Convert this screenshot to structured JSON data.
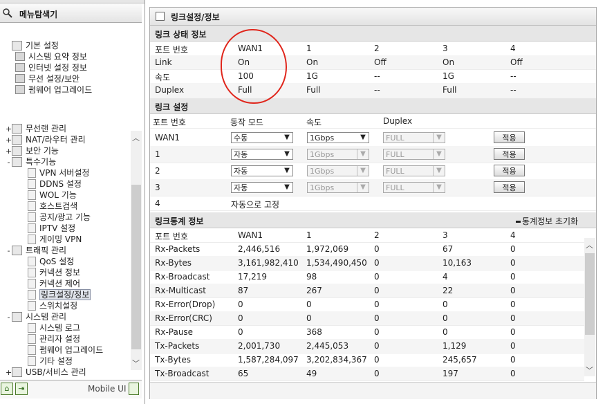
{
  "left_panel": {
    "header": "메뉴탐색기",
    "tree": [
      {
        "label": "기본 설정",
        "level": 0,
        "expander": ""
      },
      {
        "label": "시스템 요약 정보",
        "level": 1
      },
      {
        "label": "인터넷 설정 정보",
        "level": 1
      },
      {
        "label": "무선 설정/보안",
        "level": 1
      },
      {
        "label": "펌웨어 업그레이드",
        "level": 1
      },
      {
        "label": "무선랜 관리",
        "level": 0,
        "expander": "+"
      },
      {
        "label": "NAT/라우터 관리",
        "level": 0,
        "expander": "+"
      },
      {
        "label": "보안 기능",
        "level": 0,
        "expander": "+"
      },
      {
        "label": "특수기능",
        "level": 0,
        "expander": "-"
      },
      {
        "label": "VPN 서버설정",
        "level": 2
      },
      {
        "label": "DDNS 설정",
        "level": 2
      },
      {
        "label": "WOL 기능",
        "level": 2
      },
      {
        "label": "호스트검색",
        "level": 2
      },
      {
        "label": "공지/광고 기능",
        "level": 2
      },
      {
        "label": "IPTV 설정",
        "level": 2
      },
      {
        "label": "게이밍 VPN",
        "level": 2
      },
      {
        "label": "트래픽 관리",
        "level": 0,
        "expander": "-"
      },
      {
        "label": "QoS 설정",
        "level": 2
      },
      {
        "label": "커넥션 정보",
        "level": 2
      },
      {
        "label": "커넥션 제어",
        "level": 2
      },
      {
        "label": "링크설정/정보",
        "level": 2,
        "selected": true
      },
      {
        "label": "스위치설정",
        "level": 2
      },
      {
        "label": "시스템 관리",
        "level": 0,
        "expander": "-"
      },
      {
        "label": "시스템 로그",
        "level": 2
      },
      {
        "label": "관리자 설정",
        "level": 2
      },
      {
        "label": "펌웨어 업그레이드",
        "level": 2
      },
      {
        "label": "기타 설정",
        "level": 2
      },
      {
        "label": "USB/서비스 관리",
        "level": 0,
        "expander": "+"
      }
    ],
    "footer": {
      "mobile_label": "Mobile UI"
    }
  },
  "main": {
    "title": "링크설정/정보",
    "link_status": {
      "section_title": "링크 상태 정보",
      "header": [
        "포트 번호",
        "WAN1",
        "1",
        "2",
        "3",
        "4"
      ],
      "rows": [
        [
          "Link",
          "On",
          "On",
          "Off",
          "On",
          "Off"
        ],
        [
          "속도",
          "100",
          "1G",
          "--",
          "1G",
          "--"
        ],
        [
          "Duplex",
          "Full",
          "Full",
          "--",
          "Full",
          "--"
        ]
      ]
    },
    "link_config": {
      "section_title": "링크 설정",
      "header": [
        "포트 번호",
        "동작 모드",
        "속도",
        "Duplex"
      ],
      "rows": [
        {
          "port": "WAN1",
          "mode": "수동",
          "speed": "1Gbps",
          "duplex": "FULL",
          "apply": "적용",
          "speed_enabled": true
        },
        {
          "port": "1",
          "mode": "자동",
          "speed": "1Gbps",
          "duplex": "FULL",
          "apply": "적용",
          "speed_enabled": false
        },
        {
          "port": "2",
          "mode": "자동",
          "speed": "1Gbps",
          "duplex": "FULL",
          "apply": "적용",
          "speed_enabled": false
        },
        {
          "port": "3",
          "mode": "자동",
          "speed": "1Gbps",
          "duplex": "FULL",
          "apply": "적용",
          "speed_enabled": false
        }
      ],
      "fixed_row": {
        "port": "4",
        "text": "자동으로 고정"
      }
    },
    "link_stats": {
      "section_title": "링크통계 정보",
      "reset_label": "통계정보 초기화",
      "header": [
        "포트 번호",
        "WAN1",
        "1",
        "2",
        "3",
        "4"
      ],
      "rows": [
        [
          "Rx-Packets",
          "2,446,516",
          "1,972,069",
          "0",
          "67",
          "0"
        ],
        [
          "Rx-Bytes",
          "3,161,982,410",
          "1,534,490,450",
          "0",
          "10,163",
          "0"
        ],
        [
          "Rx-Broadcast",
          "17,219",
          "98",
          "0",
          "4",
          "0"
        ],
        [
          "Rx-Multicast",
          "87",
          "267",
          "0",
          "22",
          "0"
        ],
        [
          "Rx-Error(Drop)",
          "0",
          "0",
          "0",
          "0",
          "0"
        ],
        [
          "Rx-Error(CRC)",
          "0",
          "0",
          "0",
          "0",
          "0"
        ],
        [
          "Rx-Pause",
          "0",
          "368",
          "0",
          "0",
          "0"
        ],
        [
          "Tx-Packets",
          "2,001,730",
          "2,445,053",
          "0",
          "1,129",
          "0"
        ],
        [
          "Tx-Bytes",
          "1,587,284,097",
          "3,202,834,367",
          "0",
          "245,657",
          "0"
        ],
        [
          "Tx-Broadcast",
          "65",
          "49",
          "0",
          "197",
          "0"
        ]
      ]
    },
    "colors": {
      "annotation_circle": "#e0261c"
    }
  }
}
